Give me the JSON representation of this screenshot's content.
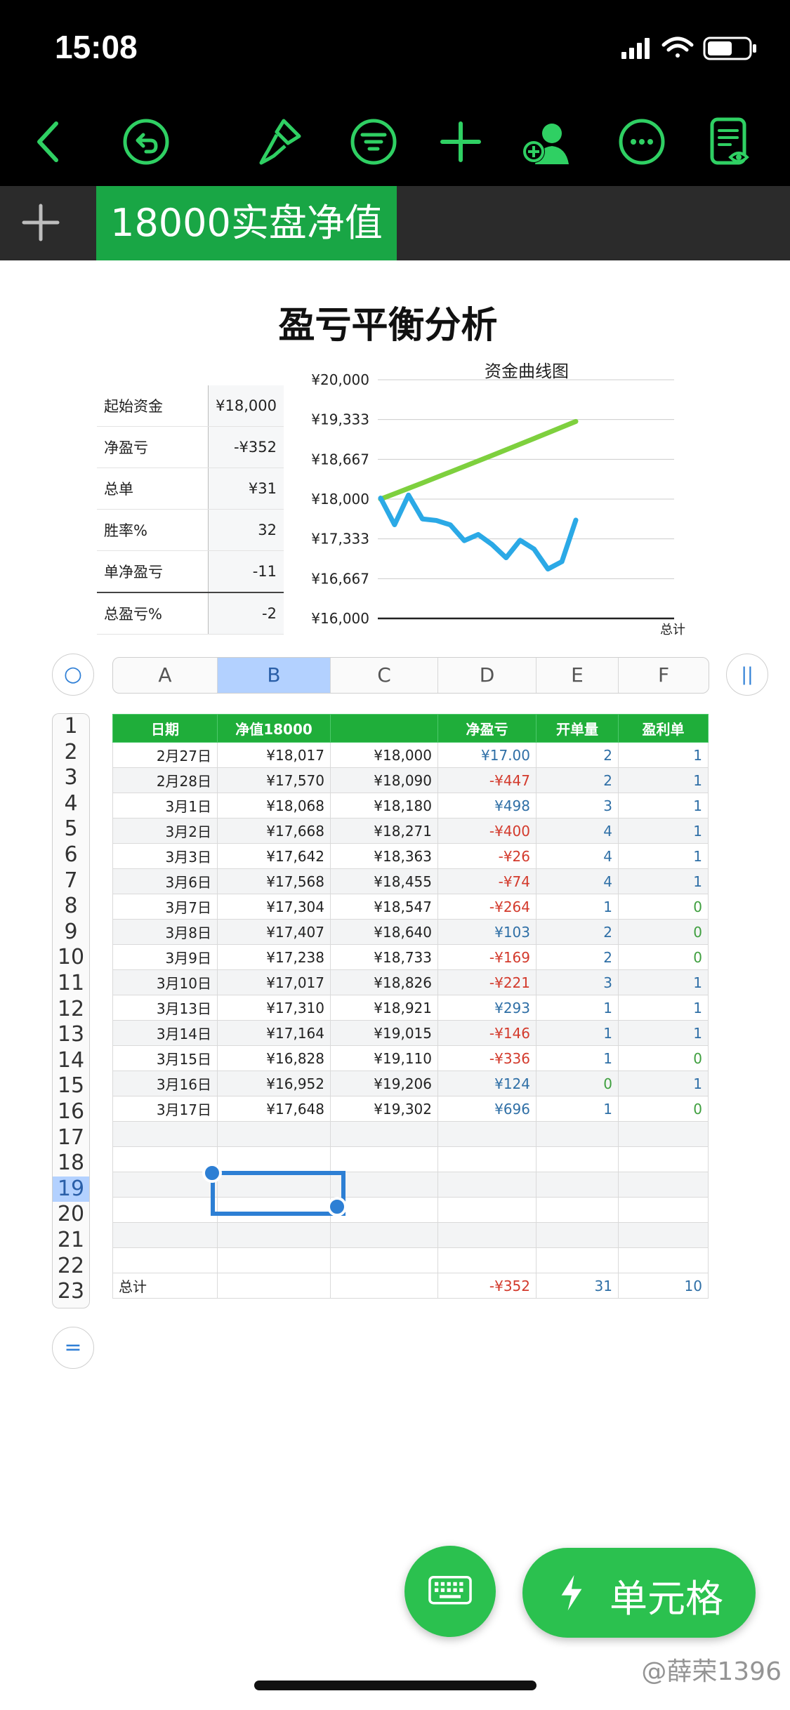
{
  "status": {
    "time": "15:08"
  },
  "toolbar": {
    "icons": [
      "back-icon",
      "undo-icon",
      "paintbrush-icon",
      "filter-icon",
      "add-icon",
      "collaborate-icon",
      "more-icon",
      "reading-view-icon"
    ]
  },
  "tabs": [
    {
      "label": "18000实盘净值",
      "active": true
    }
  ],
  "sheet": {
    "title": "盈亏平衡分析",
    "summary": [
      {
        "label": "起始资金",
        "value": "¥18,000"
      },
      {
        "label": "净盈亏",
        "value": "-¥352"
      },
      {
        "label": "总单",
        "value": "¥31"
      },
      {
        "label": "胜率%",
        "value": "32"
      },
      {
        "label": "单净盈亏",
        "value": "-11"
      },
      {
        "label": "总盈亏%",
        "value": "-2"
      }
    ]
  },
  "chart_data": {
    "type": "line",
    "title": "资金曲线图",
    "yticks": [
      "¥20,000",
      "¥19,333",
      "¥18,667",
      "¥18,000",
      "¥17,333",
      "¥16,667",
      "¥16,000"
    ],
    "ylim": [
      16000,
      20000
    ],
    "xlabel_partial": "总计",
    "series": [
      {
        "color": "#2ba9e6",
        "values": [
          18017,
          17570,
          18068,
          17668,
          17642,
          17568,
          17304,
          17407,
          17238,
          17017,
          17310,
          17164,
          16828,
          16952,
          17648
        ]
      },
      {
        "color": "#7ed03e",
        "values": [
          18000,
          18090,
          18180,
          18271,
          18363,
          18455,
          18547,
          18640,
          18733,
          18826,
          18921,
          19015,
          19110,
          19206,
          19302
        ]
      }
    ]
  },
  "columns": [
    "A",
    "B",
    "C",
    "D",
    "E",
    "F"
  ],
  "selected_column": "B",
  "rows_count": 23,
  "selected_row": 19,
  "table": {
    "headers": [
      "日期",
      "净值18000",
      "",
      "净盈亏",
      "开单量",
      "盈利单"
    ],
    "rows": [
      [
        "2月27日",
        "¥18,017",
        "¥18,000",
        "¥17.00",
        "2",
        "1"
      ],
      [
        "2月28日",
        "¥17,570",
        "¥18,090",
        "-¥447",
        "2",
        "1"
      ],
      [
        "3月1日",
        "¥18,068",
        "¥18,180",
        "¥498",
        "3",
        "1"
      ],
      [
        "3月2日",
        "¥17,668",
        "¥18,271",
        "-¥400",
        "4",
        "1"
      ],
      [
        "3月3日",
        "¥17,642",
        "¥18,363",
        "-¥26",
        "4",
        "1"
      ],
      [
        "3月6日",
        "¥17,568",
        "¥18,455",
        "-¥74",
        "4",
        "1"
      ],
      [
        "3月7日",
        "¥17,304",
        "¥18,547",
        "-¥264",
        "1",
        "0"
      ],
      [
        "3月8日",
        "¥17,407",
        "¥18,640",
        "¥103",
        "2",
        "0"
      ],
      [
        "3月9日",
        "¥17,238",
        "¥18,733",
        "-¥169",
        "2",
        "0"
      ],
      [
        "3月10日",
        "¥17,017",
        "¥18,826",
        "-¥221",
        "3",
        "1"
      ],
      [
        "3月13日",
        "¥17,310",
        "¥18,921",
        "¥293",
        "1",
        "1"
      ],
      [
        "3月14日",
        "¥17,164",
        "¥19,015",
        "-¥146",
        "1",
        "1"
      ],
      [
        "3月15日",
        "¥16,828",
        "¥19,110",
        "-¥336",
        "1",
        "0"
      ],
      [
        "3月16日",
        "¥16,952",
        "¥19,206",
        "¥124",
        "0",
        "1"
      ],
      [
        "3月17日",
        "¥17,648",
        "¥19,302",
        "¥696",
        "1",
        "0"
      ]
    ],
    "total": [
      "总计",
      "",
      "",
      "-¥352",
      "31",
      "10"
    ]
  },
  "buttons": {
    "keyboard": "keyboard-icon",
    "cell": "单元格"
  },
  "watermark": "@薛荣1396"
}
